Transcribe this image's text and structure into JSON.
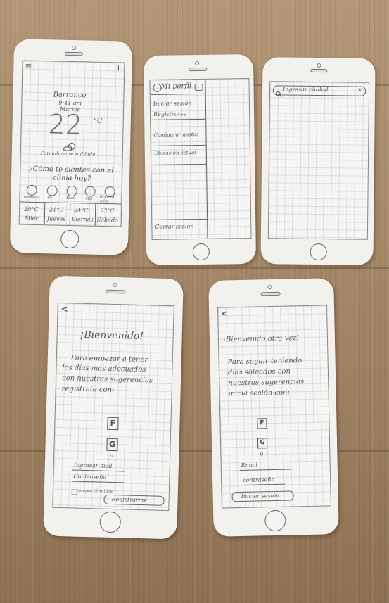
{
  "weather_screen": {
    "menu_glyph": "≡",
    "add_glyph": "+",
    "location": [
      "Barranco",
      "9:41 am",
      "Martes"
    ],
    "temperature": "22",
    "unit": "°C",
    "condition": "Parcialmente nublado",
    "prompt": [
      "¿Cómo te sientes con el",
      "clima hoy?"
    ],
    "moods": [
      "Incomodo",
      "Ok",
      "Bien",
      "Mal",
      "Necesito calor"
    ],
    "forecast": [
      {
        "temp": "20°C",
        "day": "Mier"
      },
      {
        "temp": "21°C",
        "day": "Jueves"
      },
      {
        "temp": "24°C",
        "day": "Viernes"
      },
      {
        "temp": "23°C",
        "day": "Sábado"
      }
    ]
  },
  "menu_screen": {
    "header": "Mi perfil",
    "items": [
      "Iniciar sesión",
      "Registrarse",
      "Configurar gustos",
      "Ubicación actual"
    ],
    "footer": "Cerrar sesión"
  },
  "search_screen": {
    "placeholder": "Ingresar ciudad",
    "close_glyph": "✕"
  },
  "register_screen": {
    "back_glyph": "<",
    "title": "¡Bienvenido!",
    "body": [
      "Para empezar a tener",
      "los días más adecuados",
      "con nuestras sugerencias",
      "regístrate con:"
    ],
    "facebook": "F",
    "google": "G",
    "or": "o",
    "email": "Ingresar mail",
    "password": "Contraseña",
    "terms": "Acepto términos",
    "button": "Registrarme"
  },
  "login_screen": {
    "back_glyph": "<",
    "title": "¡Bienvenido otra vez!",
    "body": [
      "Para seguir teniendo",
      "días soleados con",
      "nuestras sugerencias",
      "inicia sesión con:"
    ],
    "facebook": "F",
    "google": "G",
    "or": "o",
    "email": "Email",
    "password": "contraseña",
    "button": "Iniciar sesión"
  }
}
